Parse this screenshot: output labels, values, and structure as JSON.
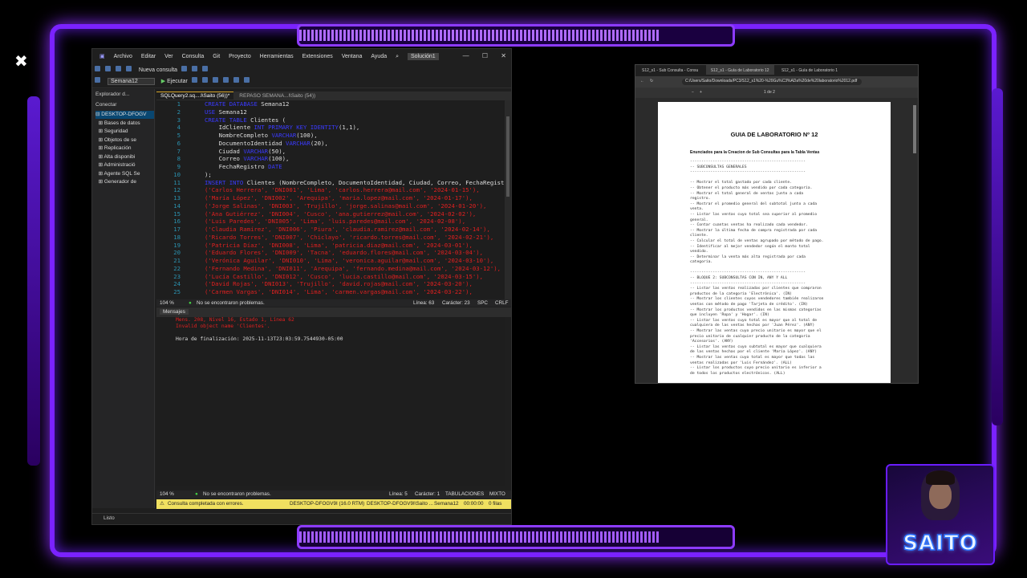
{
  "overlay": {
    "close_symbol": "✖",
    "streamer_name": "SAITO"
  },
  "ssms": {
    "menu": [
      "Archivo",
      "Editar",
      "Ver",
      "Consulta",
      "Git",
      "Proyecto",
      "Herramientas",
      "Extensiones",
      "Ventana",
      "Ayuda"
    ],
    "solution_label": "Solución1",
    "new_query": "Nueva consulta",
    "database": "Semana12",
    "execute": "Ejecutar",
    "object_explorer": {
      "title": "Explorador d...",
      "connect": "Conectar",
      "nodes": [
        "DESKTOP-DFOGV",
        "Bases de datos",
        "Seguridad",
        "Objetos de se",
        "Replicación",
        "Alta disponibi",
        "Administració",
        "Agente SQL Se",
        "Generador de"
      ]
    },
    "tabs": [
      "SQLQuery2.sq....l\\Saito (56))*",
      "REPASO SEMANA...l\\Saito (54))"
    ],
    "code_lines": [
      {
        "n": "1",
        "parts": [
          {
            "k": "kw",
            "t": "CREATE DATABASE"
          },
          {
            "k": "",
            "t": " Semana12"
          }
        ]
      },
      {
        "n": "2",
        "parts": [
          {
            "k": "kw",
            "t": "USE"
          },
          {
            "k": "",
            "t": " Semana12"
          }
        ]
      },
      {
        "n": "3",
        "parts": [
          {
            "k": "kw",
            "t": "CREATE TABLE"
          },
          {
            "k": "",
            "t": " Clientes ("
          }
        ]
      },
      {
        "n": "4",
        "parts": [
          {
            "k": "",
            "t": "    IdCliente "
          },
          {
            "k": "kw",
            "t": "INT PRIMARY KEY IDENTITY"
          },
          {
            "k": "",
            "t": "(1,1),"
          }
        ]
      },
      {
        "n": "5",
        "parts": [
          {
            "k": "",
            "t": "    NombreCompleto "
          },
          {
            "k": "kw",
            "t": "VARCHAR"
          },
          {
            "k": "",
            "t": "(100),"
          }
        ]
      },
      {
        "n": "6",
        "parts": [
          {
            "k": "",
            "t": "    DocumentoIdentidad "
          },
          {
            "k": "kw",
            "t": "VARCHAR"
          },
          {
            "k": "",
            "t": "(20),"
          }
        ]
      },
      {
        "n": "7",
        "parts": [
          {
            "k": "",
            "t": "    Ciudad "
          },
          {
            "k": "kw",
            "t": "VARCHAR"
          },
          {
            "k": "",
            "t": "(50),"
          }
        ]
      },
      {
        "n": "8",
        "parts": [
          {
            "k": "",
            "t": "    Correo "
          },
          {
            "k": "kw",
            "t": "VARCHAR"
          },
          {
            "k": "",
            "t": "(100),"
          }
        ]
      },
      {
        "n": "9",
        "parts": [
          {
            "k": "",
            "t": "    FechaRegistro "
          },
          {
            "k": "kw",
            "t": "DATE"
          }
        ]
      },
      {
        "n": "10",
        "parts": [
          {
            "k": "",
            "t": ");"
          }
        ]
      },
      {
        "n": "11",
        "parts": [
          {
            "k": "kw",
            "t": "INSERT INTO"
          },
          {
            "k": "",
            "t": " Clientes (NombreCompleto, DocumentoIdentidad, Ciudad, Correo, FechaRegistro)"
          }
        ]
      },
      {
        "n": "12",
        "parts": [
          {
            "k": "str",
            "t": "('Carlos Herrera', 'DNI001', 'Lima', 'carlos.herrera@mail.com', '2024-01-15'),"
          }
        ]
      },
      {
        "n": "13",
        "parts": [
          {
            "k": "str",
            "t": "('María López', 'DNI002', 'Arequipa', 'maria.lopez@mail.com', '2024-01-17'),"
          }
        ]
      },
      {
        "n": "14",
        "parts": [
          {
            "k": "str",
            "t": "('Jorge Salinas', 'DNI003', 'Trujillo', 'jorge.salinas@mail.com', '2024-01-20'),"
          }
        ]
      },
      {
        "n": "15",
        "parts": [
          {
            "k": "str",
            "t": "('Ana Gutiérrez', 'DNI004', 'Cusco', 'ana.gutierrez@mail.com', '2024-02-02'),"
          }
        ]
      },
      {
        "n": "16",
        "parts": [
          {
            "k": "str",
            "t": "('Luis Paredes', 'DNI005', 'Lima', 'luis.paredes@mail.com', '2024-02-08'),"
          }
        ]
      },
      {
        "n": "17",
        "parts": [
          {
            "k": "str",
            "t": "('Claudia Ramírez', 'DNI006', 'Piura', 'claudia.ramirez@mail.com', '2024-02-14'),"
          }
        ]
      },
      {
        "n": "18",
        "parts": [
          {
            "k": "str",
            "t": "('Ricardo Torres', 'DNI007', 'Chiclayo', 'ricardo.torres@mail.com', '2024-02-21'),"
          }
        ]
      },
      {
        "n": "19",
        "parts": [
          {
            "k": "str",
            "t": "('Patricia Díaz', 'DNI008', 'Lima', 'patricia.diaz@mail.com', '2024-03-01'),"
          }
        ]
      },
      {
        "n": "20",
        "parts": [
          {
            "k": "str",
            "t": "('Eduardo Flores', 'DNI009', 'Tacna', 'eduardo.flores@mail.com', '2024-03-04'),"
          }
        ]
      },
      {
        "n": "21",
        "parts": [
          {
            "k": "str",
            "t": "('Verónica Aguilar', 'DNI010', 'Lima', 'veronica.aguilar@mail.com', '2024-03-10'),"
          }
        ]
      },
      {
        "n": "22",
        "parts": [
          {
            "k": "str",
            "t": "('Fernando Medina', 'DNI011', 'Arequipa', 'fernando.medina@mail.com', '2024-03-12'),"
          }
        ]
      },
      {
        "n": "23",
        "parts": [
          {
            "k": "str",
            "t": "('Lucía Castillo', 'DNI012', 'Cusco', 'lucia.castillo@mail.com', '2024-03-15'),"
          }
        ]
      },
      {
        "n": "24",
        "parts": [
          {
            "k": "str",
            "t": "('David Rojas', 'DNI013', 'Trujillo', 'david.rojas@mail.com', '2024-03-20'),"
          }
        ]
      },
      {
        "n": "25",
        "parts": [
          {
            "k": "str",
            "t": "('Carmen Vargas', 'DNI014', 'Lima', 'carmen.vargas@mail.com', '2024-03-22'),"
          }
        ]
      }
    ],
    "status_editor": {
      "zoom": "104 %",
      "msg": "No se encontraron problemas.",
      "line": "Línea: 63",
      "char": "Carácter: 23",
      "spc": "SPC",
      "crlf": "CRLF"
    },
    "messages_tab": "Mensajes",
    "messages": [
      "Mens. 208, Nivel 16, Estado 1, Línea 62",
      "Invalid object name 'Clientes'.",
      "",
      "Hora de finalización: 2025-11-13T23:03:59.7544930-05:00"
    ],
    "status_results": {
      "zoom": "104 %",
      "msg": "No se encontraron problemas.",
      "line": "Línea: 5",
      "char": "Carácter: 1",
      "tab": "TABULACIONES",
      "mixed": "MIXTO"
    },
    "yellow": {
      "msg": "Consulta completada con errores.",
      "server": "DESKTOP-DFOGV9I (16.0 RTM)",
      "user": "DESKTOP-DFOGV9I\\Saito ...",
      "db": "Semana12",
      "time": "00:00:00",
      "rows": "0 filas"
    },
    "ready": "Listo"
  },
  "pdf": {
    "tabs": [
      "S12_s1 - Sub Consulta - Consu",
      "S12_s1 - Guía de Laboratorio 12",
      "S12_s1 - Guía de Laboratorio 1"
    ],
    "address": "C:/Users/Saito/Downloads/PC3/S12_s1%20-%20Gu%C3%ADa%20de%20laboratorio%2012.pdf",
    "page_info": "1 de 2",
    "title": "GUIA DE LABORATORIO Nº 12",
    "subtitle": "Enunciados para la Creacion de Sub Consultas para la Tabla Ventas",
    "lines": [
      "---------------------------------------------------",
      "-- SUBCONSULTAS GENERALES",
      "---------------------------------------------------",
      "",
      "-- Mostrar el total gastado por cada cliente.",
      "-- Obtener el producto más vendido por cada categoría.",
      "-- Mostrar el total general de ventas junto a cada",
      "registro.",
      "-- Mostrar el promedio general del subtotal junto a cada",
      "venta.",
      "-- Listar las ventas cuyo total sea superior al promedio",
      "general.",
      "-- Contar cuantas ventas ha realizado cada vendedor.",
      "-- Mostrar la última fecha de compra registrada por cada",
      "cliente.",
      "-- Calcular el total de ventas agrupado por método de pago.",
      "-- Identificar al mejor vendedor según el monto total",
      "vendido.",
      "-- Determinar la venta más alta registrada por cada",
      "categoría.",
      "",
      "---------------------------------------------------",
      "-- BLOQUE 2: SUBCONSULTAS CON IN, ANY Y ALL",
      "---------------------------------------------------",
      "-- Listar las ventas realizadas por clientes que compraron",
      "productos de la categoría 'Electrónica'. (IN)",
      "-- Mostrar los clientes cuyos vendedores también realizaron",
      "ventas con método de pago 'Tarjeta de crédito'. (IN)",
      "-- Mostrar los productos vendidos en las mismas categorías",
      "que incluyen 'Ropa' y 'Hogar'. (IN)",
      "-- Listar las ventas cuyo total es mayor que al total de",
      "cualquiera de las ventas hechas por 'Juan Pérez'. (ANY)",
      "-- Mostrar las ventas cuyo precio unitario es mayor que el",
      "precio unitario de cualquier producto de la categoría",
      "'Accesorios'. (ANY)",
      "-- Listar las ventas cuyo subtotal es mayor que cualquiera",
      "de las ventas hechas por el cliente 'María López'. (ANY)",
      "-- Mostrar las ventas cuyo total es mayor que todas las",
      "ventas realizadas por 'Luis Fernández'. (ALL)",
      "-- Listar los productos cuyo precio unitario es inferior a",
      "de todos los productos electrónicos. (ALL)"
    ]
  }
}
